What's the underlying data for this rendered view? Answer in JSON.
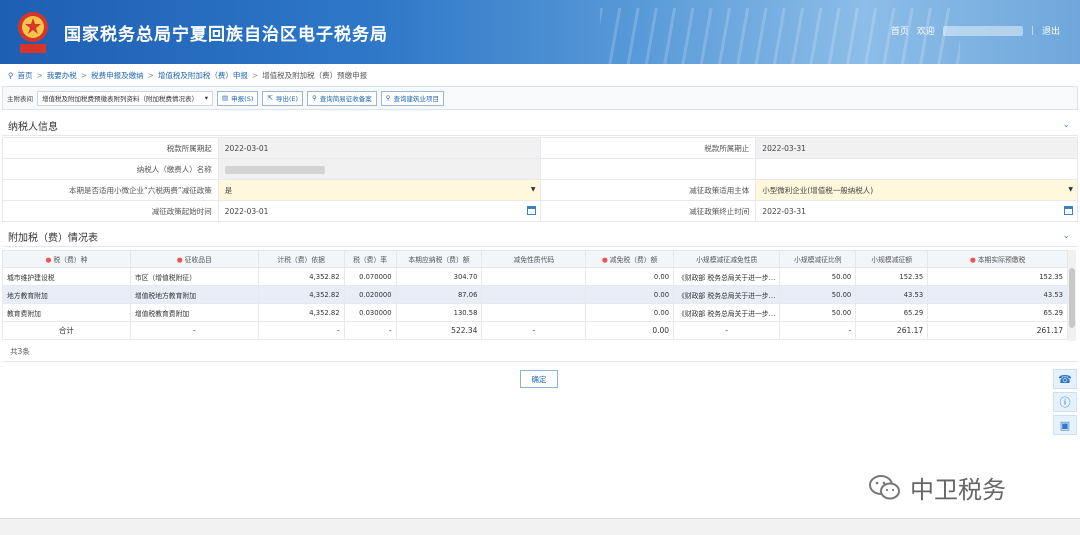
{
  "header": {
    "site_title": "国家税务总局宁夏回族自治区电子税务局",
    "home_label": "首页",
    "welcome_label": "欢迎",
    "logout_label": "退出"
  },
  "breadcrumb": {
    "items": [
      "首页",
      "我要办税",
      "税费申报及缴纳",
      "增值税及附加税（费）申报",
      "增值税及附加税（费）预缴申报"
    ]
  },
  "toolbar": {
    "main_table_label": "主附表间",
    "main_table_value": "增值税及附加税费预缴表附列资料（附加税费情况表）",
    "declare_label": "申报(S)",
    "export_label": "导出(E)",
    "query_simple_label": "查询简易征收备案",
    "query_project_label": "查询建筑业项目"
  },
  "taxpayer": {
    "section_title": "纳税人信息",
    "period_start_label": "税款所属期起",
    "period_start": "2022-03-01",
    "period_end_label": "税款所属期止",
    "period_end": "2022-03-31",
    "name_label": "纳税人（缴费人）名称",
    "policy_label": "本期是否适用小微企业“六税两费”减征政策",
    "policy_value": "是",
    "subject_label": "减征政策适用主体",
    "subject_value": "小型微利企业(增值税一般纳税人)",
    "policy_start_label": "减征政策起始时间",
    "policy_start": "2022-03-01",
    "policy_end_label": "减征政策终止时间",
    "policy_end": "2022-03-31"
  },
  "surtax": {
    "section_title": "附加税（费）情况表",
    "headers": [
      "税（费）种",
      "征收品目",
      "计税（费）依据",
      "税（费）率",
      "本期应纳税（费）额",
      "减免性质代码",
      "减免税（费）额",
      "小规模减征减免性质",
      "小规模减征比例",
      "小规模减征额",
      "本期实际预缴税"
    ],
    "rows": [
      [
        "城市维护建设税",
        "市区（增值税附征）",
        "4,352.82",
        "0.070000",
        "304.70",
        "",
        "0.00",
        "《财政部 税务总局关于进一步…",
        "50.00",
        "152.35",
        "152.35"
      ],
      [
        "地方教育附加",
        "增值税地方教育附加",
        "4,352.82",
        "0.020000",
        "87.06",
        "",
        "0.00",
        "《财政部 税务总局关于进一步…",
        "50.00",
        "43.53",
        "43.53"
      ],
      [
        "教育费附加",
        "增值税教育费附加",
        "4,352.82",
        "0.030000",
        "130.58",
        "",
        "0.00",
        "《财政部 税务总局关于进一步…",
        "50.00",
        "65.29",
        "65.29"
      ]
    ],
    "total": [
      "合计",
      "-",
      "-",
      "-",
      "522.34",
      "-",
      "0.00",
      "-",
      "-",
      "261.17",
      "261.17"
    ],
    "count_label": "共3条"
  },
  "confirm_label": "确定",
  "watermark_text": "中卫税务",
  "colors": {
    "header": "#1d5fb3",
    "accent": "#1f66b7",
    "required": "#e55555"
  }
}
